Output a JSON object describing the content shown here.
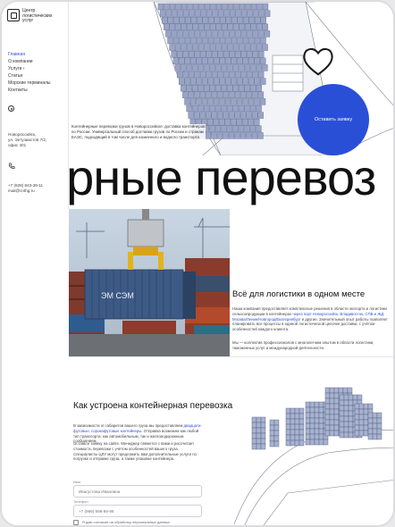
{
  "logo": {
    "name": "Центр логистических услуг"
  },
  "nav": {
    "items": [
      {
        "label": "Главная",
        "active": true
      },
      {
        "label": "О компании",
        "active": false
      },
      {
        "label": "Услуги ›",
        "active": false
      },
      {
        "label": "Статьи",
        "active": false
      },
      {
        "label": "Морские терминалы",
        "active": false
      },
      {
        "label": "Контакты",
        "active": false
      }
    ]
  },
  "address": {
    "line1": "Новороссийск,",
    "line2": "ул. Энтузиастов 7/2,",
    "line3": "офис 401"
  },
  "contacts": {
    "phone": "+7 (928) 843-39-11",
    "email": "mail@cnthg.ru"
  },
  "hero": {
    "description": "Контейнерные перевозки грузов в Новороссийске: доставка контейнеров по России. Универсальный способ доставки грузов по России и странам ЕАЭС, подходящий в том числе для назначного и водного транспорта",
    "cta": "Оставить заявку"
  },
  "headline": "ерные перевоз",
  "logistics": {
    "title": "Всё для логистики в одном месте",
    "text_a": "Наша компания предоставляет комплексные решения в области экспорта и логистики сельхозпродукции в контейнерах ",
    "text_link": "через порт Новороссийск, Владивосток, СПБ и ЖД: Москва/Ленин/Новгород/Екатеринбург",
    "text_b": " и другие. Значительный опыт работы позволяет планировать все процессы в единой логистической цепочке доставки, с учётом особенностей каждого клиента.",
    "text2": "Мы — коллектив профессионалов с многолетним опытом в области логистики, таможенных услуг и международной деятельности."
  },
  "how": {
    "title": "Как устроена контейнерная перевозка",
    "text_a": "В зависимости от габаритов вашего груза мы предоставляем ",
    "text_link": "двадцати-футовые, сорокафутовые контейнеры",
    "text_b": ". Отправка возможна как любой тип транспорта: как автомобильным, так и железнодорожным сообщением.",
    "text2": "Оставьте заявку на сайте. Менеджер свяжется с вами и рассчитает стоимость перевозки с учётом особенностей вашего груза. Специалисты ЦЛУ могут предложить вам дополнительные услуги по погрузке и отправке груза, а также упаковке контейнера.",
    "form": {
      "name_label": "Имя",
      "name_placeholder": "Ивагустова Ивановна",
      "phone_label": "Телефон",
      "phone_placeholder": "+7 (999) 999-99-99",
      "consent": "Я даю согласие на обработку персональных данных"
    }
  },
  "photo_label": "ЭМ СЭМ",
  "colors": {
    "accent": "#2a4fd7",
    "link": "#2f4fd8"
  }
}
